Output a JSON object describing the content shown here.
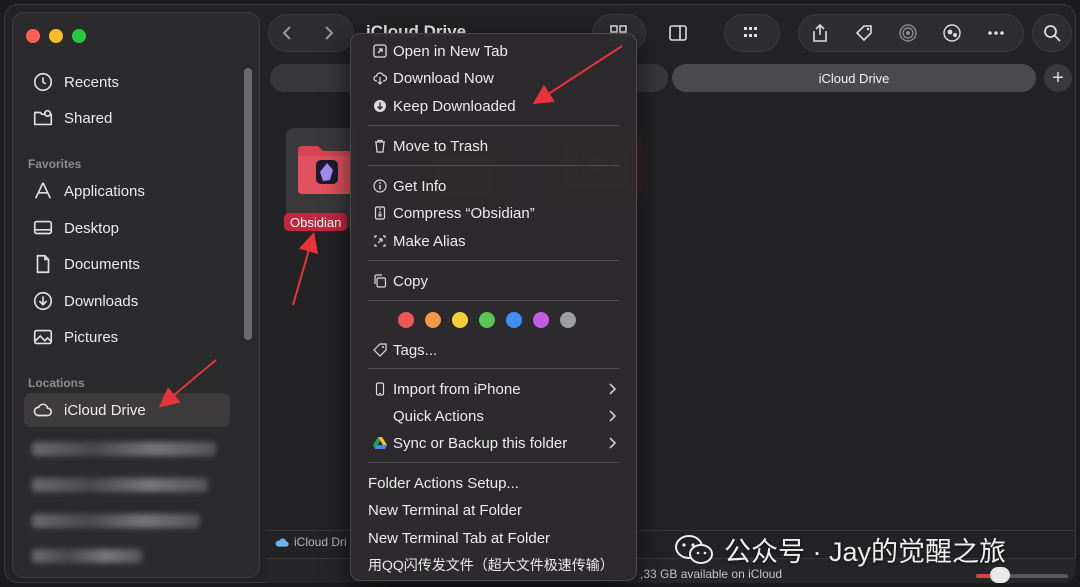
{
  "window": {
    "title": "iCloud Drive"
  },
  "sidebar": {
    "top_items": [
      {
        "label": "Recents",
        "icon": "clock-icon"
      },
      {
        "label": "Shared",
        "icon": "shared-folder-icon"
      }
    ],
    "favorites_header": "Favorites",
    "favorites": [
      {
        "label": "Applications",
        "icon": "applications-icon"
      },
      {
        "label": "Desktop",
        "icon": "desktop-icon"
      },
      {
        "label": "Documents",
        "icon": "document-icon"
      },
      {
        "label": "Downloads",
        "icon": "download-icon"
      },
      {
        "label": "Pictures",
        "icon": "pictures-icon"
      }
    ],
    "locations_header": "Locations",
    "locations": [
      {
        "label": "iCloud Drive",
        "icon": "cloud-icon",
        "selected": true
      }
    ]
  },
  "tabs": {
    "active": "iCloud Drive"
  },
  "content": {
    "folder": {
      "label": "Obsidian",
      "color": "#e0525f",
      "icon": "obsidian-folder-icon"
    }
  },
  "statusbar": {
    "path": "iCloud Dri",
    "available": ",33 GB available on iCloud"
  },
  "context_menu": {
    "items": [
      {
        "label": "Open in New Tab",
        "icon": "new-tab-icon"
      },
      {
        "label": "Download Now",
        "icon": "cloud-download-icon"
      },
      {
        "label": "Keep Downloaded",
        "icon": "keep-downloaded-icon"
      },
      {
        "label": "Move to Trash",
        "icon": "trash-icon"
      },
      {
        "label": "Get Info",
        "icon": "info-icon"
      },
      {
        "label": "Compress “Obsidian”",
        "icon": "compress-icon"
      },
      {
        "label": "Make Alias",
        "icon": "alias-icon"
      },
      {
        "label": "Copy",
        "icon": "copy-icon"
      },
      {
        "label": "Tags...",
        "icon": "tag-icon"
      },
      {
        "label": "Import from iPhone",
        "icon": "iphone-icon"
      },
      {
        "label": "Quick Actions",
        "icon": ""
      },
      {
        "label": "Sync or Backup this folder",
        "icon": "google-drive-icon"
      },
      {
        "label": "Folder Actions Setup...",
        "icon": ""
      },
      {
        "label": "New Terminal at Folder",
        "icon": ""
      },
      {
        "label": "New Terminal Tab at Folder",
        "icon": ""
      },
      {
        "label": "用QQ闪传发文件（超大文件极速传输）",
        "icon": ""
      }
    ],
    "tag_colors": [
      "#f0575a",
      "#f39a4a",
      "#f5cf3a",
      "#5ec552",
      "#3f8ef0",
      "#c35ce0",
      "#9e9ea0"
    ]
  },
  "watermark": {
    "text": "公众号 · Jay的觉醒之旅"
  }
}
